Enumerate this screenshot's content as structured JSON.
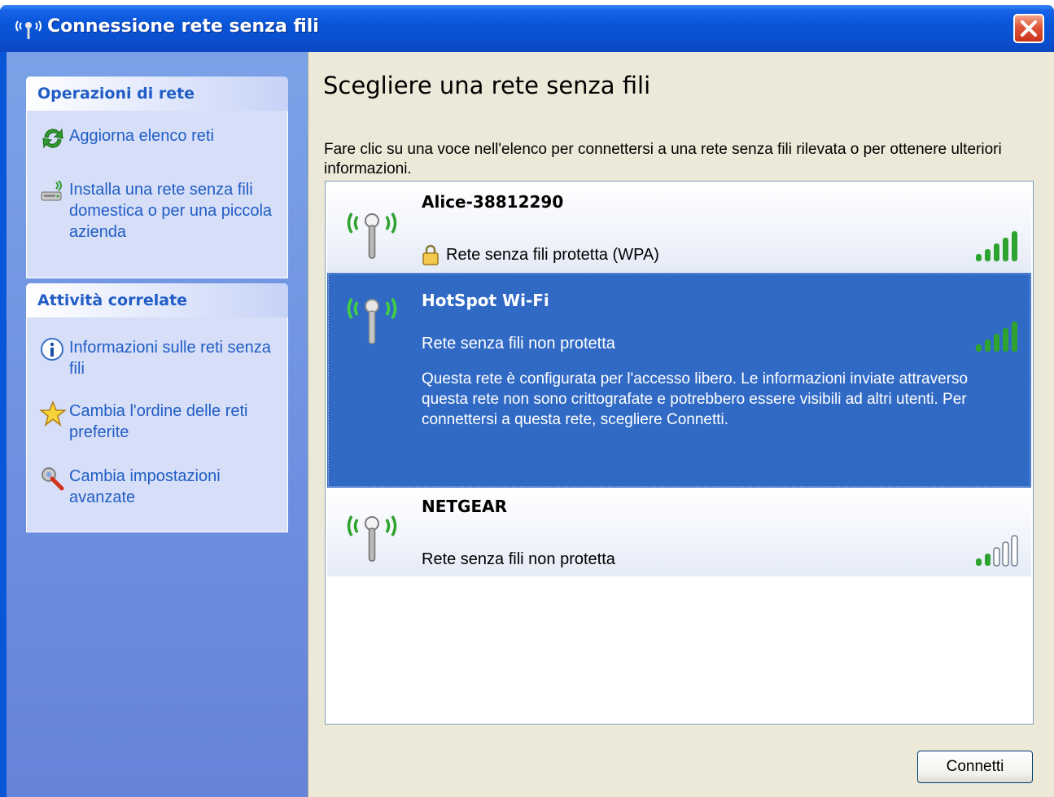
{
  "window": {
    "title": "Connessione rete senza fili",
    "close_icon": "close-icon"
  },
  "taskpane": {
    "groups": [
      {
        "title": "Operazioni di rete",
        "tasks": [
          {
            "label": "Aggiorna elenco reti",
            "icon": "refresh-icon"
          },
          {
            "label": "Installa una rete senza fili domestica o per una piccola azienda",
            "icon": "setup-network-icon"
          }
        ]
      },
      {
        "title": "Attività correlate",
        "tasks": [
          {
            "label": "Informazioni sulle reti senza fili",
            "icon": "info-icon"
          },
          {
            "label": "Cambia l'ordine delle reti preferite",
            "icon": "star-icon"
          },
          {
            "label": "Cambia impostazioni avanzate",
            "icon": "settings-wrench-icon"
          }
        ]
      }
    ]
  },
  "main": {
    "heading": "Scegliere una rete senza fili",
    "instructions": "Fare clic su una voce nell'elenco per connettersi a una rete senza fili rilevata o per ottenere ulteriori informazioni.",
    "networks": [
      {
        "ssid": "Alice-38812290",
        "security": "Rete senza fili protetta (WPA)",
        "secured": true,
        "signal_bars": 5,
        "selected": false
      },
      {
        "ssid": "HotSpot Wi-Fi",
        "security": "Rete senza fili non protetta",
        "secured": false,
        "signal_bars": 5,
        "selected": true,
        "description": "Questa rete è configurata per l'accesso libero. Le informazioni inviate attraverso questa rete non sono crittografate e potrebbero essere visibili ad altri utenti. Per connettersi a questa rete, scegliere Connetti."
      },
      {
        "ssid": "NETGEAR",
        "security": "Rete senza fili non protetta",
        "secured": false,
        "signal_bars": 2,
        "selected": false
      }
    ],
    "connect_label": "Connetti"
  },
  "colors": {
    "titlebar": "#0a56d8",
    "taskpane": "#6c8fdf",
    "task_link": "#215dc6",
    "selection": "#316ac5",
    "signal_on": "#2fa32f",
    "signal_off": "#c8d0dc"
  }
}
